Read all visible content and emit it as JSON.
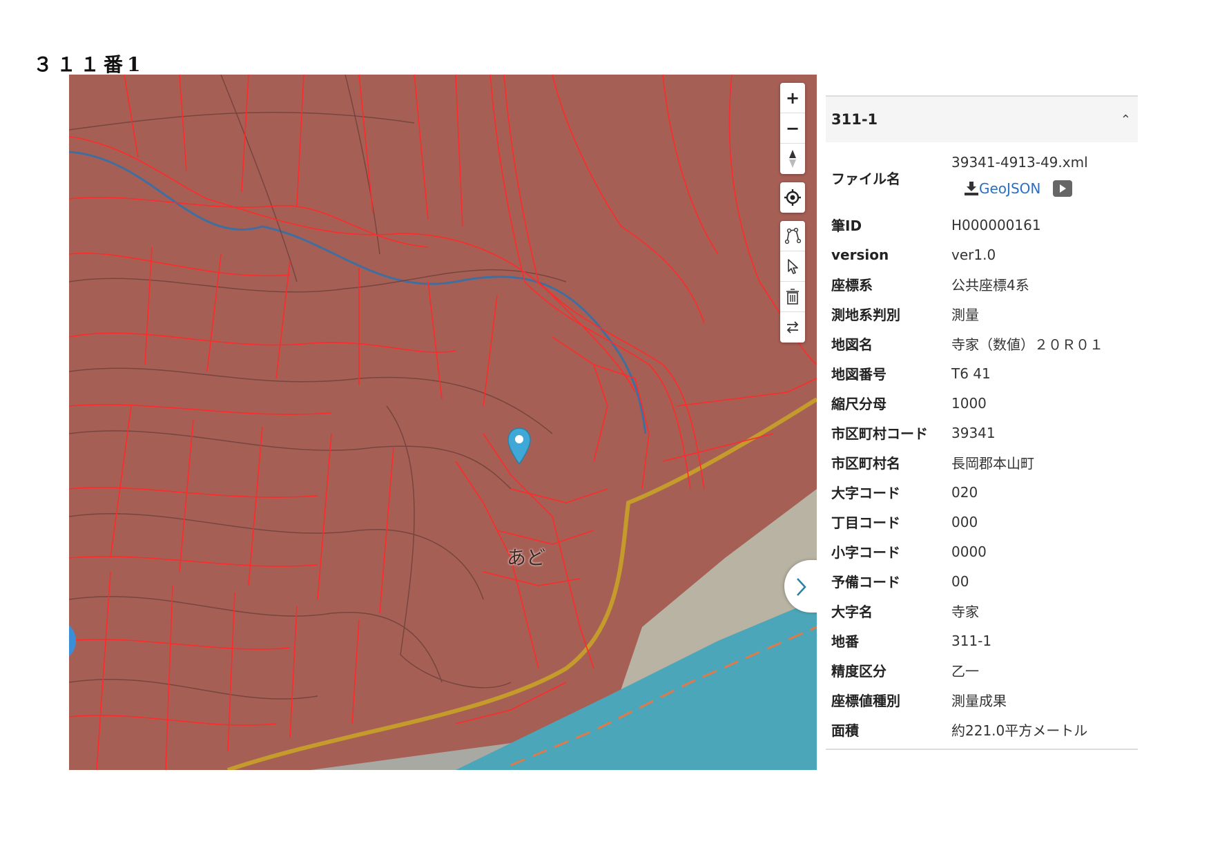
{
  "document": {
    "title": "３１１番1"
  },
  "map": {
    "place_label": "あど",
    "toolbar": {
      "zoom_in": "+",
      "zoom_out": "−"
    },
    "colors": {
      "parcel_fill": "#a65f55",
      "parcel_lines": "#ff2a2a",
      "river": "#3d9fb2",
      "road": "#c9a227",
      "marker": "#3fa8d6"
    }
  },
  "panel": {
    "header_id": "311-1",
    "file": {
      "label": "ファイル名",
      "filename": "39341-4913-49.xml",
      "geojson_link": "GeoJSON"
    },
    "rows": [
      {
        "label": "筆ID",
        "value": "H000000161"
      },
      {
        "label": "version",
        "value": "ver1.0"
      },
      {
        "label": "座標系",
        "value": "公共座標4系"
      },
      {
        "label": "測地系判別",
        "value": "測量"
      },
      {
        "label": "地図名",
        "value": "寺家（数値）２０Ｒ０１"
      },
      {
        "label": "地図番号",
        "value": "T6 41"
      },
      {
        "label": "縮尺分母",
        "value": "1000"
      },
      {
        "label": "市区町村コード",
        "value": "39341"
      },
      {
        "label": "市区町村名",
        "value": "長岡郡本山町"
      },
      {
        "label": "大字コード",
        "value": "020"
      },
      {
        "label": "丁目コード",
        "value": "000"
      },
      {
        "label": "小字コード",
        "value": "0000"
      },
      {
        "label": "予備コード",
        "value": "00"
      },
      {
        "label": "大字名",
        "value": "寺家"
      },
      {
        "label": "地番",
        "value": "311-1"
      },
      {
        "label": "精度区分",
        "value": "乙一"
      },
      {
        "label": "座標値種別",
        "value": "測量成果"
      },
      {
        "label": "面積",
        "value": "約221.0平方メートル"
      }
    ]
  }
}
